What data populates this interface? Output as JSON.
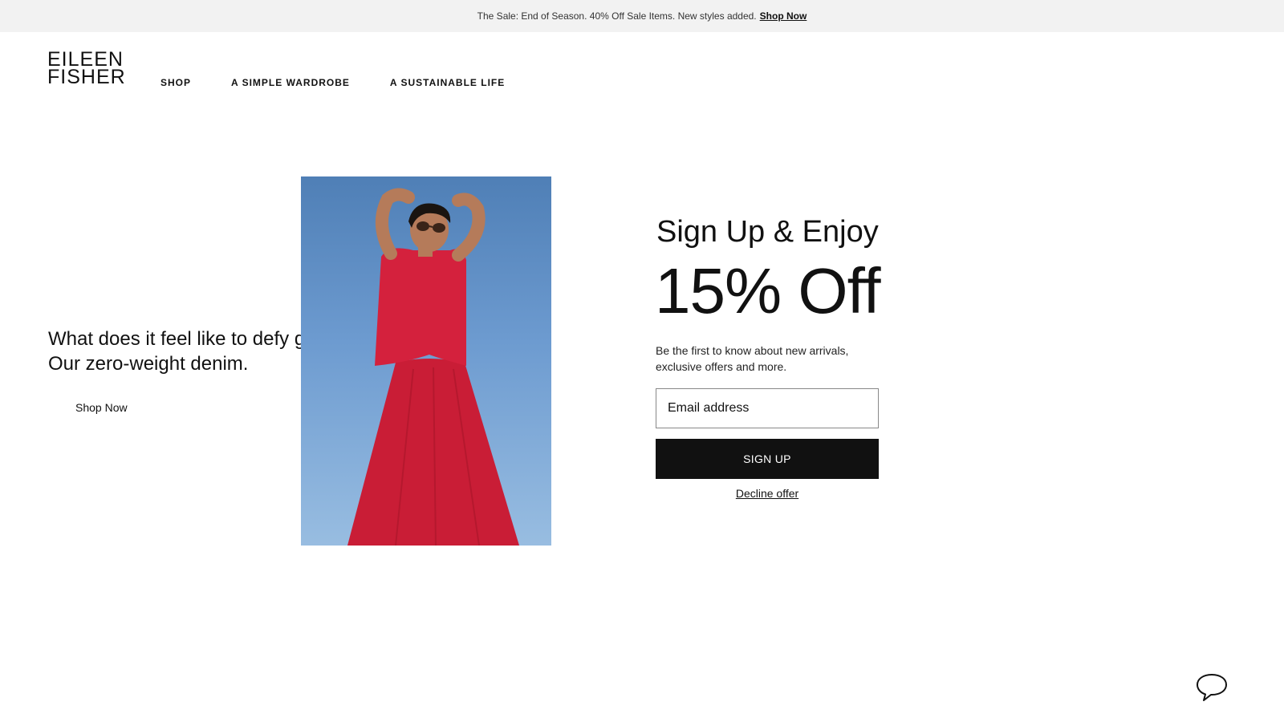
{
  "promo": {
    "text": "The Sale: End of Season. 40% Off Sale Items. New styles added.",
    "link_label": "Shop Now"
  },
  "header": {
    "logo_line1": "EILEEN",
    "logo_line2": "FISHER",
    "nav": [
      {
        "label": "SHOP"
      },
      {
        "label": "A SIMPLE WARDROBE"
      },
      {
        "label": "A SUSTAINABLE LIFE"
      }
    ]
  },
  "hero": {
    "headline_line1": "What does it feel like to defy gravity?",
    "headline_line2": "Our zero-weight denim.",
    "cta_label": "Shop Now"
  },
  "signup": {
    "title": "Sign Up & Enjoy",
    "offer": "15% Off",
    "description": "Be the first to know about new arrivals, exclusive offers and more.",
    "email_placeholder": "Email address",
    "submit_label": "SIGN UP",
    "decline_label": "Decline offer"
  },
  "chat": {
    "icon": "chat-bubble-icon"
  },
  "colors": {
    "banner_bg": "#f2f2f2",
    "primary": "#111111",
    "sky": "#6d9bd0",
    "dress_red": "#d4213d"
  }
}
